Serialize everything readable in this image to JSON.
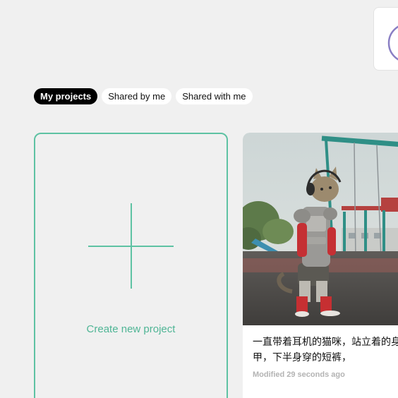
{
  "tabs": [
    {
      "label": "My projects",
      "active": true
    },
    {
      "label": "Shared by me",
      "active": false
    },
    {
      "label": "Shared with me",
      "active": false
    }
  ],
  "create_card": {
    "label": "Create new project",
    "accent_color": "#5ec2a3"
  },
  "projects": [
    {
      "description": "一直带着耳机的猫咪，站立着的身穿着盔甲，下半身穿的短裤，",
      "modified": "Modified 29 seconds ago"
    }
  ],
  "colors": {
    "background": "#f0f0f0",
    "active_tab": "#000000",
    "accent": "#5ec2a3",
    "muted_text": "#b3b3b3"
  },
  "icons": {
    "logo": "app-logo-icon",
    "plus": "plus-icon"
  }
}
